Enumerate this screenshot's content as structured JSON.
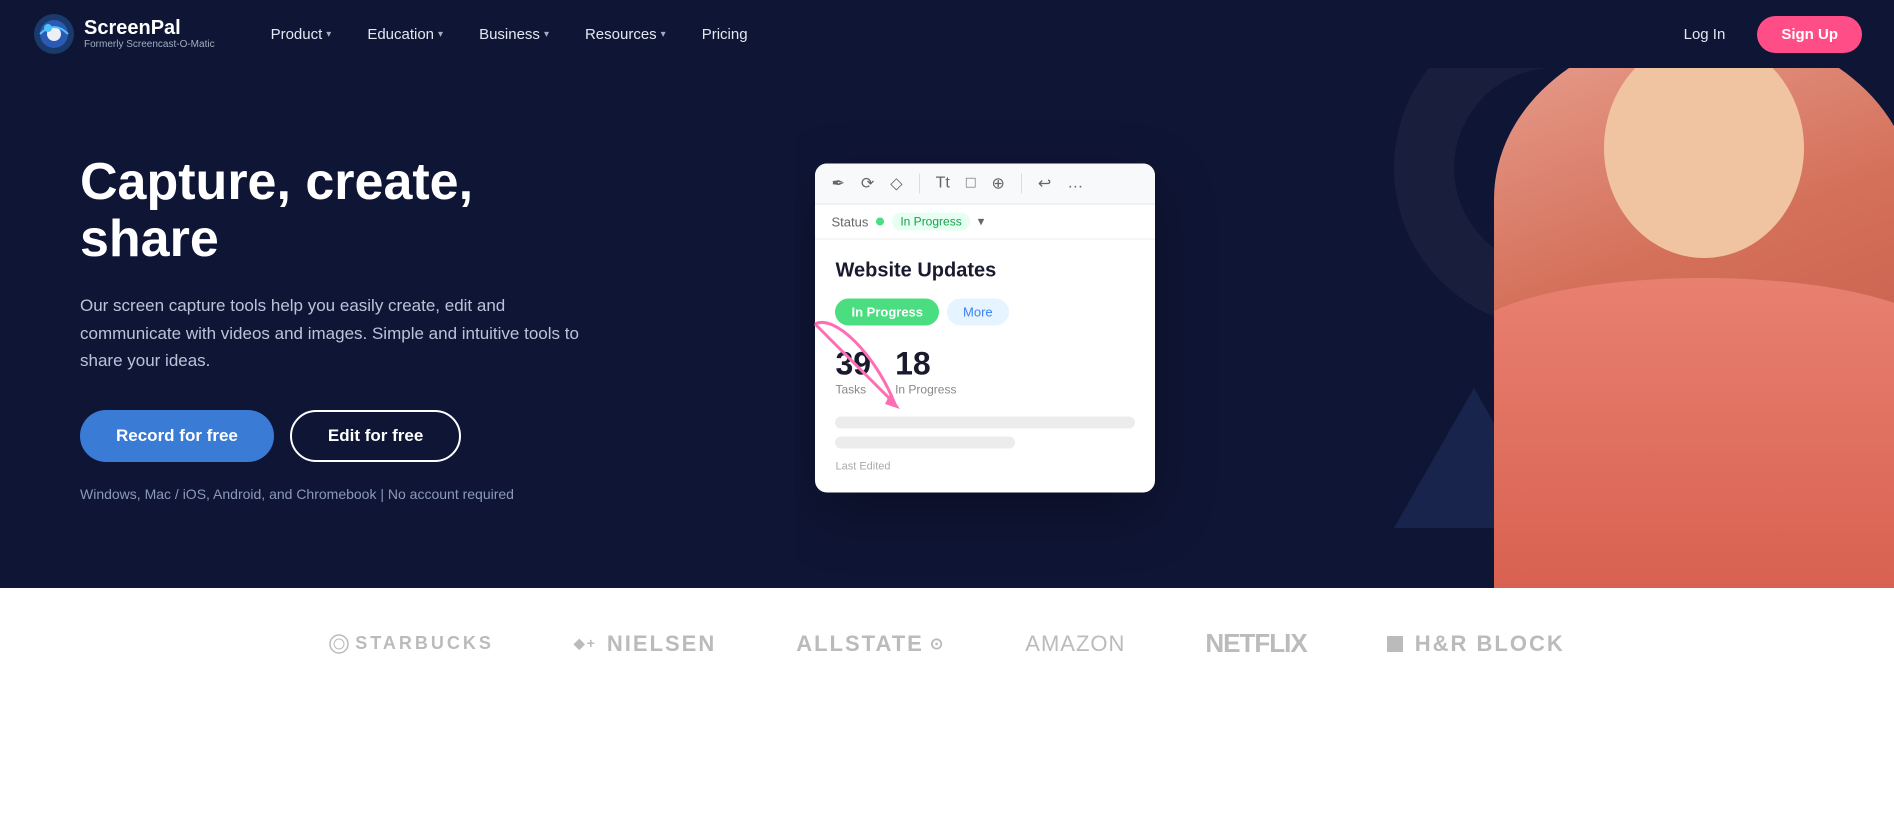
{
  "nav": {
    "logo_title": "ScreenPal",
    "logo_subtitle": "Formerly Screencast-O-Matic",
    "items": [
      {
        "id": "product",
        "label": "Product",
        "has_dropdown": true
      },
      {
        "id": "education",
        "label": "Education",
        "has_dropdown": true
      },
      {
        "id": "business",
        "label": "Business",
        "has_dropdown": true
      },
      {
        "id": "resources",
        "label": "Resources",
        "has_dropdown": true
      },
      {
        "id": "pricing",
        "label": "Pricing",
        "has_dropdown": false
      }
    ],
    "login_label": "Log In",
    "signup_label": "Sign Up"
  },
  "hero": {
    "title": "Capture, create, share",
    "description": "Our screen capture tools help you easily create, edit and communicate with videos and images. Simple and intuitive tools to share your ideas.",
    "record_button": "Record for free",
    "edit_button": "Edit for free",
    "platforms_text": "Windows, Mac / iOS, Android, and Chromebook  |  No account required"
  },
  "mockup": {
    "status_label": "Status",
    "status_value": "In Progress",
    "card_title": "Website Updates",
    "tab_active": "In Progress",
    "tab_inactive": "More",
    "stat1_number": "39",
    "stat1_label": "Tasks",
    "stat2_number": "18",
    "stat2_label": "In Progress",
    "footer_label": "Last Edited"
  },
  "toolbar": {
    "icons": [
      "✏️",
      "🔄",
      "⬜",
      "Tt",
      "□",
      "🔍",
      "↩"
    ]
  },
  "logos": [
    {
      "id": "starbucks",
      "text": "STARBUCKS"
    },
    {
      "id": "nielsen",
      "text": "◆+ Nielsen"
    },
    {
      "id": "allstate",
      "text": "Allstate ⊕"
    },
    {
      "id": "amazon",
      "text": "amazon"
    },
    {
      "id": "netflix",
      "text": "NETFLIX"
    },
    {
      "id": "hrblock",
      "text": "■ H&R BLOCK"
    }
  ],
  "colors": {
    "nav_bg": "#0f1535",
    "hero_bg": "#0f1535",
    "accent_blue": "#3a7bd5",
    "accent_pink": "#ff4d88",
    "accent_green": "#4ade80"
  }
}
